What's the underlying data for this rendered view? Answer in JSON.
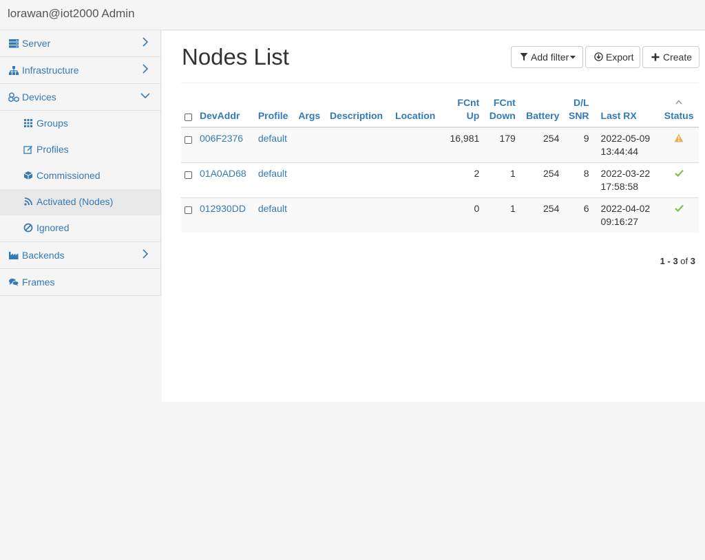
{
  "header": {
    "title": "lorawan@iot2000 Admin"
  },
  "sidebar": {
    "server": "Server",
    "infrastructure": "Infrastructure",
    "devices": "Devices",
    "sub": {
      "groups": "Groups",
      "profiles": "Profiles",
      "commissioned": "Commissioned",
      "activated": "Activated (Nodes)",
      "ignored": "Ignored"
    },
    "backends": "Backends",
    "frames": "Frames"
  },
  "main": {
    "title": "Nodes List",
    "buttons": {
      "add_filter": "Add filter",
      "export": "Export",
      "create": "Create"
    },
    "columns": {
      "devaddr": "DevAddr",
      "profile": "Profile",
      "args": "Args",
      "description": "Description",
      "location": "Location",
      "fcnt_up_1": "FCnt",
      "fcnt_up_2": "Up",
      "fcnt_down_1": "FCnt",
      "fcnt_down_2": "Down",
      "battery": "Battery",
      "dl_snr_1": "D/L",
      "dl_snr_2": "SNR",
      "last_rx": "Last RX",
      "status": "Status"
    },
    "rows": [
      {
        "devaddr": "006F2376",
        "profile": "default",
        "args": "",
        "description": "",
        "location": "",
        "fcnt_up": "16,981",
        "fcnt_down": "179",
        "battery": "254",
        "dl_snr": "9",
        "last_rx_date": "2022-05-09",
        "last_rx_time": "13:44:44",
        "status": "warning-icon"
      },
      {
        "devaddr": "01A0AD68",
        "profile": "default",
        "args": "",
        "description": "",
        "location": "",
        "fcnt_up": "2",
        "fcnt_down": "1",
        "battery": "254",
        "dl_snr": "8",
        "last_rx_date": "2022-03-22",
        "last_rx_time": "17:58:58",
        "status": "check-icon"
      },
      {
        "devaddr": "012930DD",
        "profile": "default",
        "args": "",
        "description": "",
        "location": "",
        "fcnt_up": "0",
        "fcnt_down": "1",
        "battery": "254",
        "dl_snr": "6",
        "last_rx_date": "2022-04-02",
        "last_rx_time": "09:16:27",
        "status": "check-icon"
      }
    ],
    "pagination": {
      "range": "1 - 3",
      "of_label": "of",
      "total": "3"
    }
  },
  "colors": {
    "link": "#337ab7",
    "warning": "#f0ad4e",
    "success": "#8cc152"
  }
}
